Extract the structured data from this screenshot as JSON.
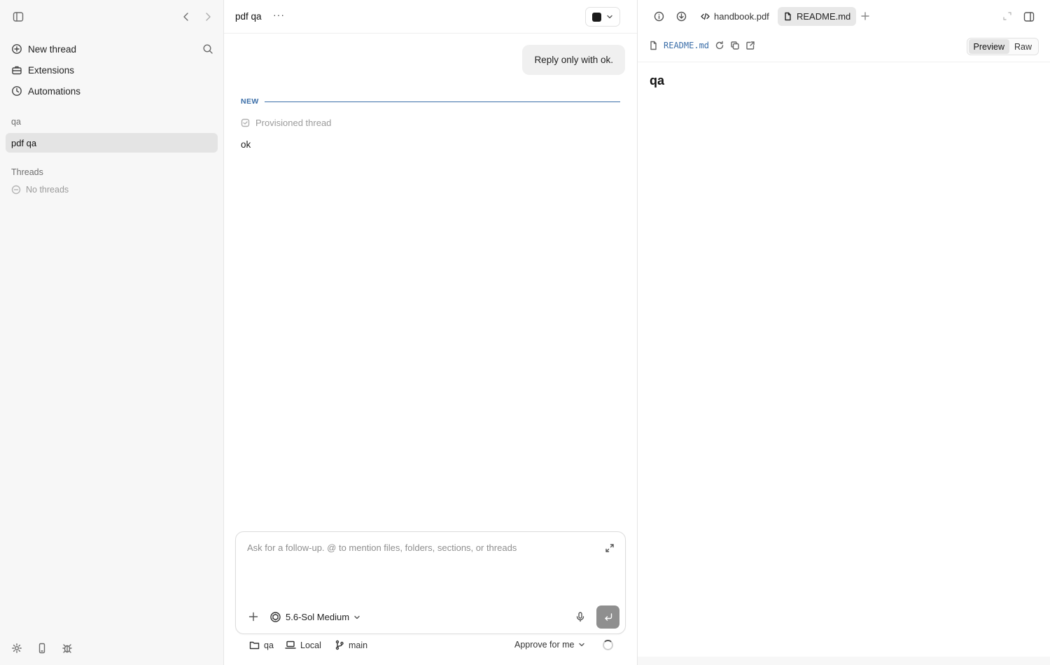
{
  "sidebar": {
    "nav": [
      {
        "label": "New thread",
        "icon": "plus-circle-icon"
      },
      {
        "label": "Extensions",
        "icon": "toolbox-icon"
      },
      {
        "label": "Automations",
        "icon": "clock-icon"
      }
    ],
    "project_section": "qa",
    "project_item": "pdf qa",
    "threads_section": "Threads",
    "threads_empty": "No threads"
  },
  "chat": {
    "title": "pdf qa",
    "more": "···",
    "user_message": "Reply only with ok.",
    "new_label": "NEW",
    "provisioned": "Provisioned thread",
    "assistant_message": "ok",
    "composer": {
      "placeholder": "Ask for a follow-up. @ to mention files, folders, sections, or threads",
      "model": "5.6-Sol Medium"
    },
    "footer": {
      "folder": "qa",
      "env": "Local",
      "branch": "main",
      "approval": "Approve for me"
    }
  },
  "preview": {
    "tabs": [
      {
        "label": "handbook.pdf",
        "active": false
      },
      {
        "label": "README.md",
        "active": true
      }
    ],
    "filename": "README.md",
    "modes": [
      "Preview",
      "Raw"
    ],
    "active_mode": "Preview",
    "heading": "qa"
  },
  "colors": {
    "accent": "#3b6ea8",
    "sidebar_bg": "#f7f7f7",
    "selected_bg": "#e4e4e4",
    "send_button": "#8f8f8f"
  }
}
